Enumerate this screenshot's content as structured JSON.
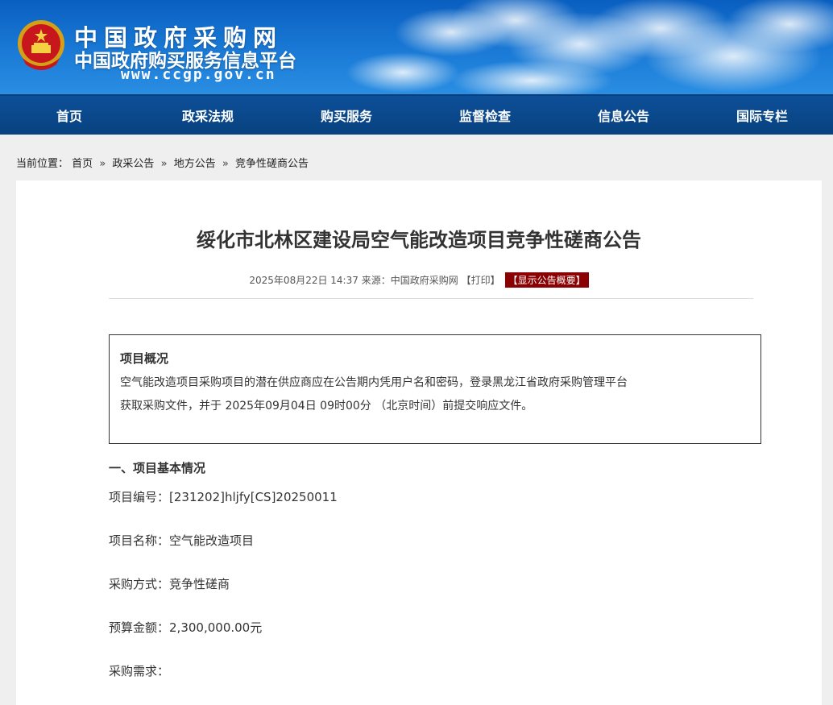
{
  "header": {
    "site_title": "中国政府采购网",
    "site_subtitle": "中国政府购买服务信息平台",
    "site_url": "www.ccgp.gov.cn",
    "emblem_icon": "national-emblem-icon",
    "colors": {
      "banner": "#1a7ad6",
      "nav": "#0b4a8f"
    }
  },
  "nav": {
    "items": [
      {
        "label": "首页"
      },
      {
        "label": "政采法规"
      },
      {
        "label": "购买服务"
      },
      {
        "label": "监督检查"
      },
      {
        "label": "信息公告"
      },
      {
        "label": "国际专栏"
      }
    ]
  },
  "breadcrumb": {
    "prefix": "当前位置：",
    "items": [
      {
        "label": "首页"
      },
      {
        "label": "政采公告"
      },
      {
        "label": "地方公告"
      },
      {
        "label": "竞争性磋商公告"
      }
    ],
    "separator": "»"
  },
  "article": {
    "title": "绥化市北林区建设局空气能改造项目竞争性磋商公告",
    "meta": {
      "datetime": "2025年08月22日 14:37",
      "source_label": "来源：",
      "source": "中国政府采购网",
      "print_label": "【打印】",
      "summary_label": "【显示公告概要】",
      "summary_color": "#8b0000"
    },
    "overview": {
      "heading": "项目概况",
      "line1": "空气能改造项目采购项目的潜在供应商应在公告期内凭用户名和密码，登录黑龙江省政府采购管理平台",
      "line2": "获取采购文件，并于 2025年09月04日 09时00分 （北京时间）前提交响应文件。"
    },
    "section1": {
      "heading": "一、项目基本情况",
      "fields": [
        {
          "label": "项目编号：",
          "value": "[231202]hljfy[CS]20250011"
        },
        {
          "label": "项目名称：",
          "value": "空气能改造项目"
        },
        {
          "label": "采购方式：",
          "value": "竞争性磋商"
        },
        {
          "label": "预算金额：",
          "value": "2,300,000.00元"
        },
        {
          "label": "采购需求：",
          "value": ""
        }
      ]
    }
  }
}
